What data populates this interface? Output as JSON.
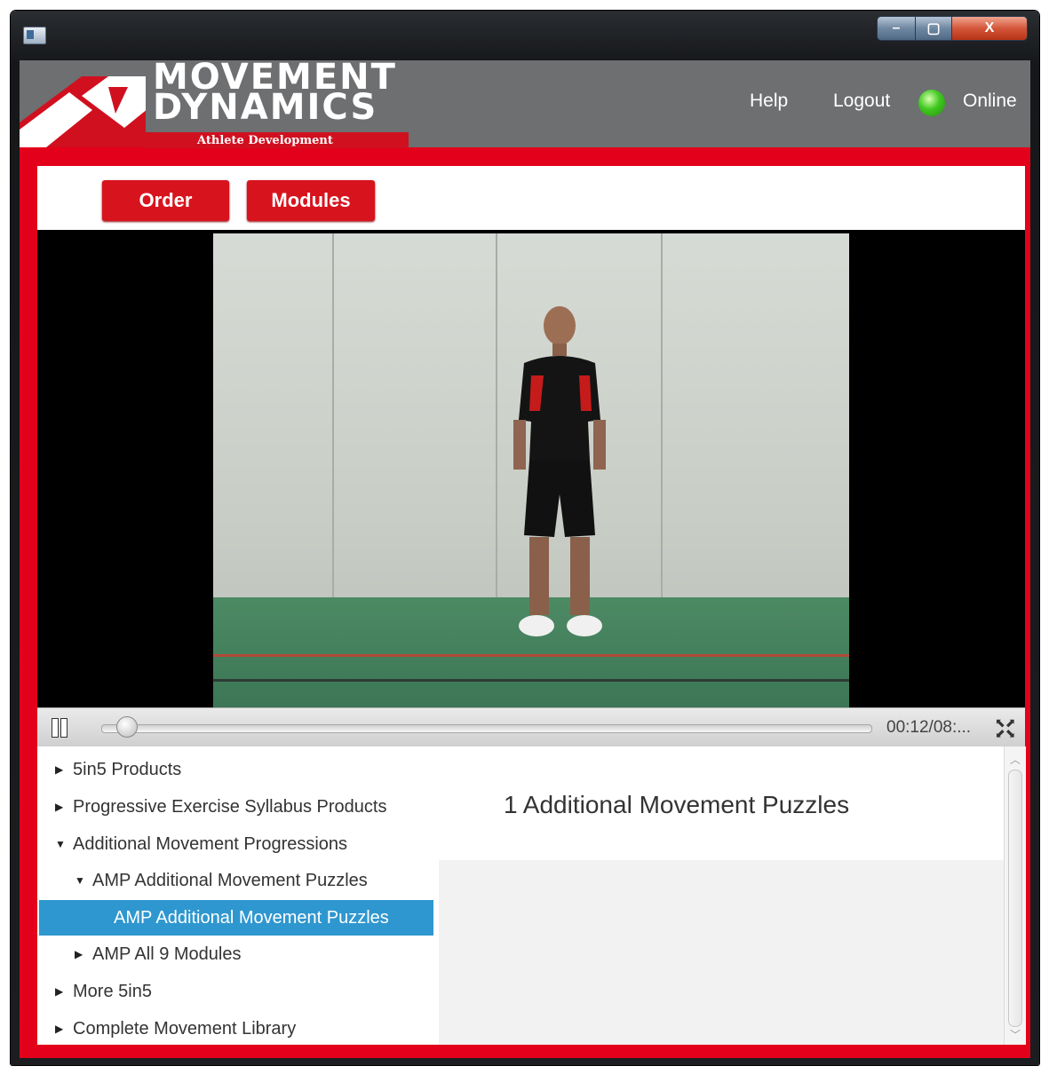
{
  "window": {
    "controls": {
      "minimize": "–",
      "maximize": "▢",
      "close": "X"
    }
  },
  "header": {
    "logo": {
      "line1": "MOVEMENT",
      "line2": "DYNAMICS",
      "tagline": "Athlete Development"
    },
    "help": "Help",
    "logout": "Logout",
    "status": "Online",
    "status_color": "#3fc81f"
  },
  "toolbar": {
    "order": "Order",
    "modules": "Modules"
  },
  "player": {
    "time": "00:12/08:...",
    "progress": 0.02,
    "state": "playing"
  },
  "tree": {
    "items": [
      {
        "label": "5in5 Products",
        "expanded": false,
        "level": 0
      },
      {
        "label": "Progressive Exercise Syllabus Products",
        "expanded": false,
        "level": 0
      },
      {
        "label": "Additional Movement Progressions",
        "expanded": true,
        "level": 0
      },
      {
        "label": "AMP Additional Movement Puzzles",
        "expanded": true,
        "level": 1
      },
      {
        "label": "AMP Additional Movement Puzzles",
        "selected": true,
        "level": 2
      },
      {
        "label": "AMP All 9 Modules",
        "expanded": false,
        "level": 1
      },
      {
        "label": "More 5in5",
        "expanded": false,
        "level": 0
      },
      {
        "label": "Complete Movement Library",
        "expanded": false,
        "level": 0
      }
    ]
  },
  "detail": {
    "title": "1  Additional Movement Puzzles"
  },
  "colors": {
    "brand_red": "#e3001b",
    "header_gray": "#6d6f71",
    "selection_blue": "#2f97cf"
  }
}
